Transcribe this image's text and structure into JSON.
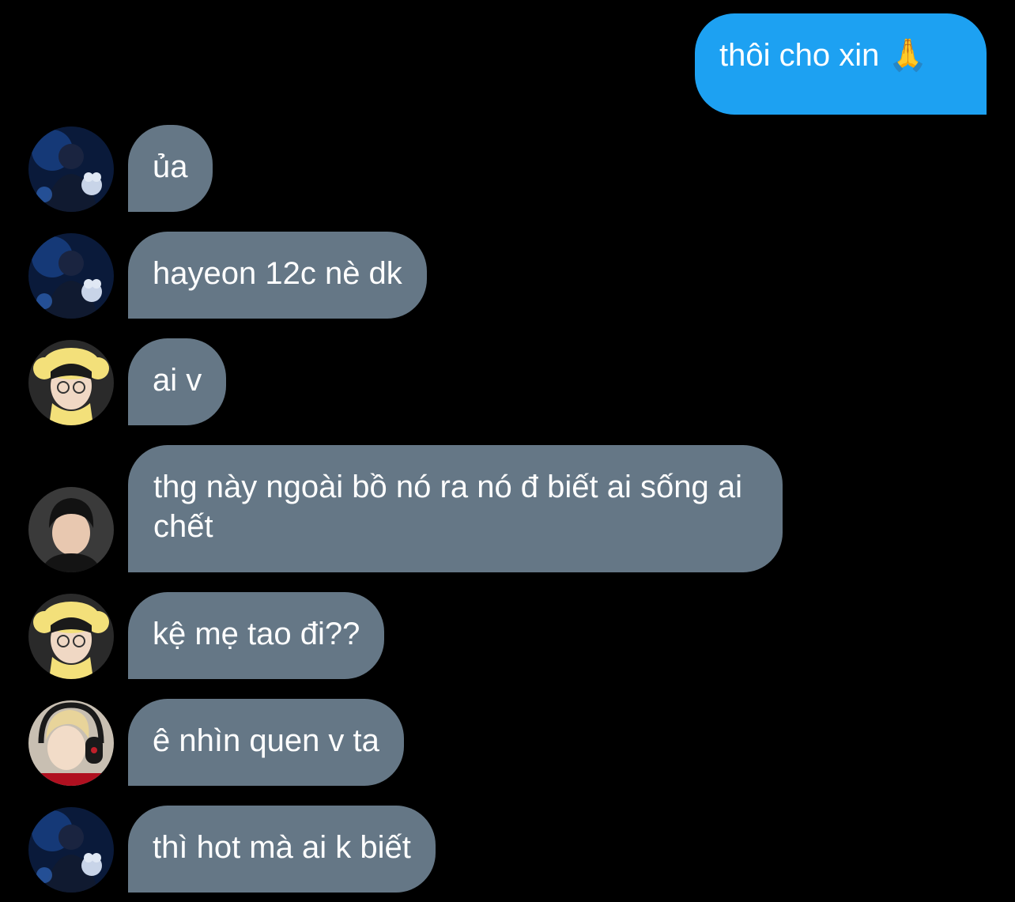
{
  "conversation": {
    "messages": [
      {
        "sender": "self",
        "text": "thôi cho xin 🙏"
      },
      {
        "sender": "avatar-blue",
        "text": "ủa"
      },
      {
        "sender": "avatar-blue",
        "text": "hayeon 12c nè dk"
      },
      {
        "sender": "avatar-yellow-hat",
        "text": "ai v"
      },
      {
        "sender": "avatar-dark-hair",
        "text": "thg này ngoài bồ nó ra nó đ biết ai sống ai chết"
      },
      {
        "sender": "avatar-yellow-hat",
        "text": "kệ mẹ tao đi??"
      },
      {
        "sender": "avatar-headphones",
        "text": "ê nhìn quen v ta"
      },
      {
        "sender": "avatar-blue",
        "text": "thì hot mà ai k biết"
      }
    ]
  },
  "colors": {
    "background": "#000000",
    "outgoing_bubble": "#1da1f2",
    "incoming_bubble": "#657786",
    "text": "#ffffff"
  }
}
